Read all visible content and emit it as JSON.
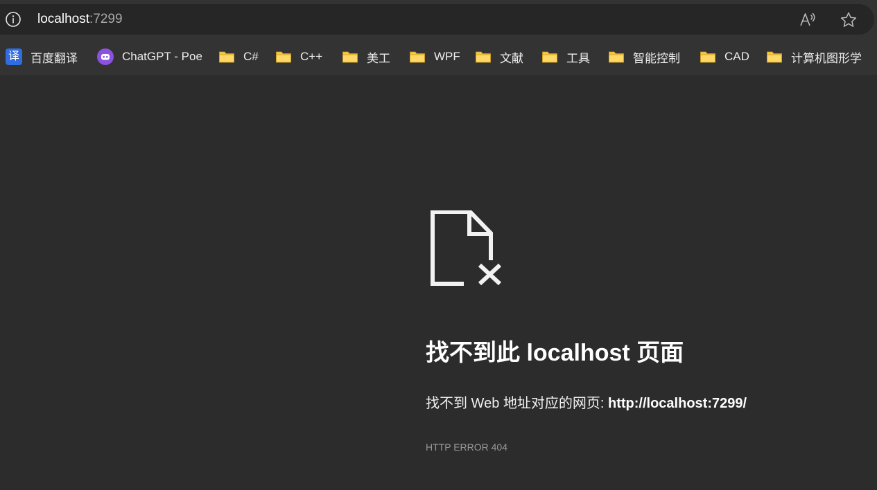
{
  "address_bar": {
    "icon": "info-icon",
    "url_host": "localhost",
    "url_port": ":7299",
    "read_aloud_icon": "read-aloud-icon",
    "favorite_icon": "star-icon"
  },
  "bookmarks": [
    {
      "label": "百度翻译",
      "icon": "fanyi-icon",
      "icon_text": "译"
    },
    {
      "label": "ChatGPT - Poe",
      "icon": "poe-icon"
    },
    {
      "label": "C#",
      "icon": "folder-icon"
    },
    {
      "label": "C++",
      "icon": "folder-icon"
    },
    {
      "label": "美工",
      "icon": "folder-icon"
    },
    {
      "label": "WPF",
      "icon": "folder-icon"
    },
    {
      "label": "文献",
      "icon": "folder-icon"
    },
    {
      "label": "工具",
      "icon": "folder-icon"
    },
    {
      "label": "智能控制",
      "icon": "folder-icon"
    },
    {
      "label": "CAD",
      "icon": "folder-icon"
    },
    {
      "label": "计算机图形学",
      "icon": "folder-icon"
    }
  ],
  "error": {
    "icon": "page-not-found-icon",
    "title": "找不到此 localhost 页面",
    "desc_prefix": "找不到 Web 地址对应的网页: ",
    "desc_url": "http://localhost:7299/",
    "code": "HTTP ERROR 404"
  },
  "colors": {
    "background": "#2c2c2c",
    "toolbar": "#333333",
    "address_field": "#262626",
    "folder": "#f7c948",
    "text_muted": "#9a9a9a"
  }
}
